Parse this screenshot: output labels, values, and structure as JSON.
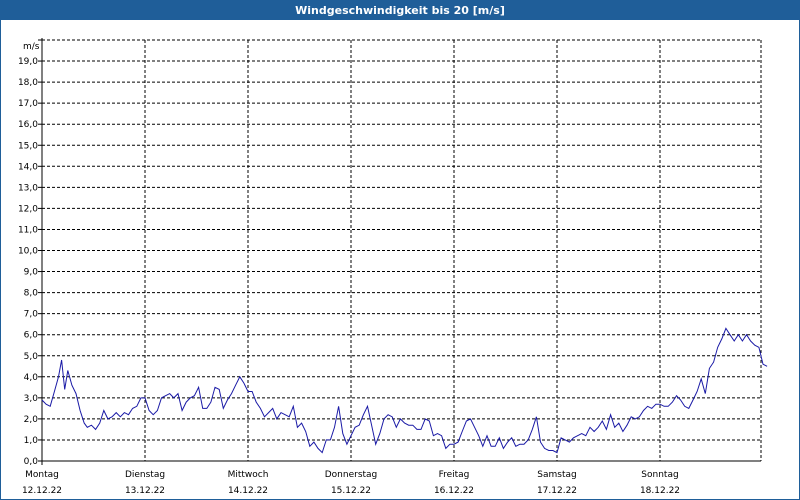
{
  "window": {
    "title": "Windgeschwindigkeit bis 20 [m/s]"
  },
  "chart_data": {
    "type": "line",
    "title": "Windgeschwindigkeit bis 20 [m/s]",
    "ylabel": "m/s",
    "ylim": [
      0,
      20
    ],
    "y_ticks": [
      "0,0",
      "1,0",
      "2,0",
      "3,0",
      "4,0",
      "5,0",
      "6,0",
      "7,0",
      "8,0",
      "9,0",
      "10,0",
      "11,0",
      "12,0",
      "13,0",
      "14,0",
      "15,0",
      "16,0",
      "17,0",
      "18,0",
      "19,0"
    ],
    "grid": true,
    "x_range_days": [
      0,
      7
    ],
    "x_ticks": [
      {
        "day": "Montag",
        "date": "12.12.22"
      },
      {
        "day": "Dienstag",
        "date": "13.12.22"
      },
      {
        "day": "Mittwoch",
        "date": "14.12.22"
      },
      {
        "day": "Donnerstag",
        "date": "15.12.22"
      },
      {
        "day": "Freitag",
        "date": "16.12.22"
      },
      {
        "day": "Samstag",
        "date": "17.12.22"
      },
      {
        "day": "Sonntag",
        "date": "18.12.22"
      }
    ],
    "line_color": "#1a1aa6",
    "series": [
      {
        "name": "",
        "points": [
          [
            0.0,
            2.9
          ],
          [
            0.04,
            2.7
          ],
          [
            0.08,
            2.6
          ],
          [
            0.12,
            3.3
          ],
          [
            0.16,
            4.0
          ],
          [
            0.19,
            4.8
          ],
          [
            0.22,
            3.4
          ],
          [
            0.25,
            4.3
          ],
          [
            0.29,
            3.6
          ],
          [
            0.33,
            3.2
          ],
          [
            0.37,
            2.4
          ],
          [
            0.41,
            1.8
          ],
          [
            0.44,
            1.6
          ],
          [
            0.48,
            1.7
          ],
          [
            0.52,
            1.5
          ],
          [
            0.56,
            1.8
          ],
          [
            0.6,
            2.4
          ],
          [
            0.64,
            2.0
          ],
          [
            0.68,
            2.1
          ],
          [
            0.72,
            2.3
          ],
          [
            0.76,
            2.1
          ],
          [
            0.8,
            2.3
          ],
          [
            0.84,
            2.2
          ],
          [
            0.88,
            2.5
          ],
          [
            0.92,
            2.6
          ],
          [
            0.96,
            3.0
          ],
          [
            1.0,
            3.0
          ],
          [
            1.04,
            2.4
          ],
          [
            1.08,
            2.2
          ],
          [
            1.12,
            2.4
          ],
          [
            1.16,
            3.0
          ],
          [
            1.2,
            3.1
          ],
          [
            1.24,
            3.2
          ],
          [
            1.28,
            3.0
          ],
          [
            1.32,
            3.2
          ],
          [
            1.36,
            2.4
          ],
          [
            1.4,
            2.8
          ],
          [
            1.44,
            3.0
          ],
          [
            1.48,
            3.1
          ],
          [
            1.52,
            3.5
          ],
          [
            1.56,
            2.5
          ],
          [
            1.6,
            2.5
          ],
          [
            1.64,
            2.8
          ],
          [
            1.68,
            3.5
          ],
          [
            1.72,
            3.4
          ],
          [
            1.76,
            2.5
          ],
          [
            1.8,
            2.9
          ],
          [
            1.84,
            3.2
          ],
          [
            1.88,
            3.6
          ],
          [
            1.92,
            4.0
          ],
          [
            1.96,
            3.7
          ],
          [
            2.0,
            3.3
          ],
          [
            2.04,
            3.3
          ],
          [
            2.08,
            2.8
          ],
          [
            2.12,
            2.5
          ],
          [
            2.16,
            2.1
          ],
          [
            2.2,
            2.3
          ],
          [
            2.24,
            2.5
          ],
          [
            2.28,
            2.0
          ],
          [
            2.32,
            2.3
          ],
          [
            2.36,
            2.2
          ],
          [
            2.4,
            2.1
          ],
          [
            2.44,
            2.6
          ],
          [
            2.48,
            1.6
          ],
          [
            2.52,
            1.8
          ],
          [
            2.56,
            1.4
          ],
          [
            2.6,
            0.7
          ],
          [
            2.64,
            0.9
          ],
          [
            2.68,
            0.6
          ],
          [
            2.72,
            0.4
          ],
          [
            2.76,
            1.0
          ],
          [
            2.8,
            1.0
          ],
          [
            2.84,
            1.6
          ],
          [
            2.88,
            2.6
          ],
          [
            2.92,
            1.3
          ],
          [
            2.96,
            0.8
          ],
          [
            3.0,
            1.2
          ],
          [
            3.04,
            1.6
          ],
          [
            3.08,
            1.7
          ],
          [
            3.12,
            2.2
          ],
          [
            3.16,
            2.6
          ],
          [
            3.2,
            1.7
          ],
          [
            3.24,
            0.8
          ],
          [
            3.28,
            1.3
          ],
          [
            3.32,
            2.0
          ],
          [
            3.36,
            2.2
          ],
          [
            3.4,
            2.1
          ],
          [
            3.44,
            1.6
          ],
          [
            3.48,
            2.0
          ],
          [
            3.52,
            1.8
          ],
          [
            3.56,
            1.7
          ],
          [
            3.6,
            1.7
          ],
          [
            3.64,
            1.5
          ],
          [
            3.68,
            1.5
          ],
          [
            3.72,
            2.0
          ],
          [
            3.76,
            1.9
          ],
          [
            3.8,
            1.2
          ],
          [
            3.84,
            1.3
          ],
          [
            3.88,
            1.2
          ],
          [
            3.92,
            0.6
          ],
          [
            3.96,
            0.8
          ],
          [
            4.0,
            0.8
          ],
          [
            4.04,
            0.9
          ],
          [
            4.08,
            1.4
          ],
          [
            4.12,
            1.9
          ],
          [
            4.16,
            2.0
          ],
          [
            4.2,
            1.6
          ],
          [
            4.24,
            1.2
          ],
          [
            4.28,
            0.7
          ],
          [
            4.32,
            1.2
          ],
          [
            4.36,
            0.7
          ],
          [
            4.4,
            0.7
          ],
          [
            4.44,
            1.1
          ],
          [
            4.48,
            0.6
          ],
          [
            4.52,
            0.9
          ],
          [
            4.56,
            1.1
          ],
          [
            4.6,
            0.7
          ],
          [
            4.64,
            0.8
          ],
          [
            4.68,
            0.8
          ],
          [
            4.72,
            1.0
          ],
          [
            4.76,
            1.5
          ],
          [
            4.8,
            2.1
          ],
          [
            4.84,
            0.9
          ],
          [
            4.88,
            0.6
          ],
          [
            4.92,
            0.5
          ],
          [
            4.96,
            0.5
          ],
          [
            5.0,
            0.4
          ],
          [
            5.04,
            1.1
          ],
          [
            5.08,
            1.0
          ],
          [
            5.12,
            0.9
          ],
          [
            5.16,
            1.1
          ],
          [
            5.2,
            1.2
          ],
          [
            5.24,
            1.3
          ],
          [
            5.28,
            1.2
          ],
          [
            5.32,
            1.6
          ],
          [
            5.36,
            1.4
          ],
          [
            5.4,
            1.6
          ],
          [
            5.44,
            1.9
          ],
          [
            5.48,
            1.5
          ],
          [
            5.52,
            2.2
          ],
          [
            5.56,
            1.6
          ],
          [
            5.6,
            1.8
          ],
          [
            5.64,
            1.4
          ],
          [
            5.68,
            1.7
          ],
          [
            5.72,
            2.1
          ],
          [
            5.76,
            2.0
          ],
          [
            5.8,
            2.1
          ],
          [
            5.84,
            2.4
          ],
          [
            5.88,
            2.6
          ],
          [
            5.92,
            2.5
          ],
          [
            5.96,
            2.7
          ],
          [
            6.0,
            2.7
          ],
          [
            6.04,
            2.6
          ],
          [
            6.08,
            2.6
          ],
          [
            6.12,
            2.8
          ],
          [
            6.16,
            3.1
          ],
          [
            6.2,
            2.9
          ],
          [
            6.24,
            2.6
          ],
          [
            6.28,
            2.5
          ],
          [
            6.32,
            2.9
          ],
          [
            6.36,
            3.3
          ],
          [
            6.4,
            3.9
          ],
          [
            6.44,
            3.2
          ],
          [
            6.48,
            4.4
          ],
          [
            6.52,
            4.7
          ],
          [
            6.56,
            5.4
          ],
          [
            6.6,
            5.8
          ],
          [
            6.64,
            6.3
          ],
          [
            6.68,
            6.0
          ],
          [
            6.72,
            5.7
          ],
          [
            6.76,
            6.0
          ],
          [
            6.8,
            5.7
          ],
          [
            6.84,
            6.0
          ],
          [
            6.88,
            5.7
          ],
          [
            6.92,
            5.5
          ],
          [
            6.96,
            5.4
          ],
          [
            7.0,
            4.6
          ],
          [
            7.04,
            4.5
          ]
        ]
      }
    ]
  }
}
